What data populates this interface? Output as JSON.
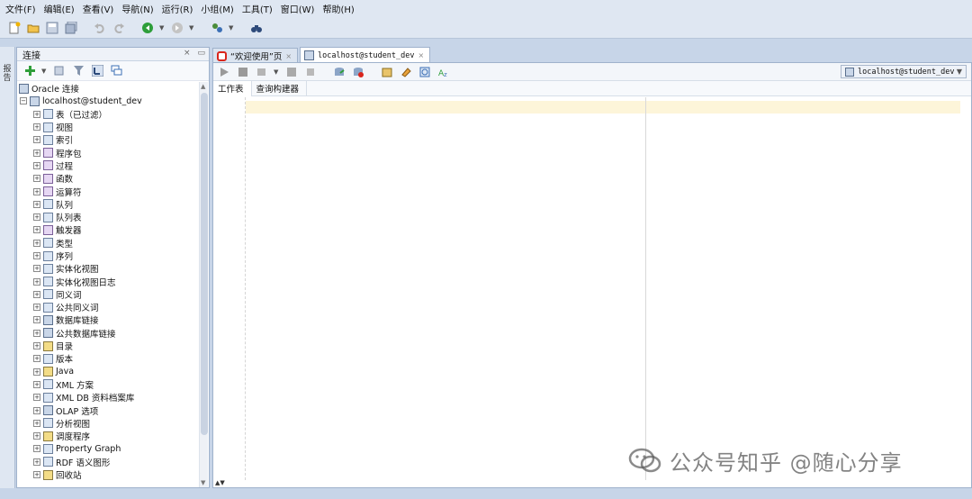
{
  "menu": [
    "文件(F)",
    "编辑(E)",
    "查看(V)",
    "导航(N)",
    "运行(R)",
    "小组(M)",
    "工具(T)",
    "窗口(W)",
    "帮助(H)"
  ],
  "left_panel": {
    "title": "连接",
    "side_strip_label": "报告"
  },
  "tree": {
    "root": "Oracle 连接",
    "connection": "localhost@student_dev",
    "children": [
      "表（已过滤）",
      "视图",
      "索引",
      "程序包",
      "过程",
      "函数",
      "运算符",
      "队列",
      "队列表",
      "触发器",
      "类型",
      "序列",
      "实体化视图",
      "实体化视图日志",
      "同义词",
      "公共同义词",
      "数据库链接",
      "公共数据库链接",
      "目录",
      "版本",
      "Java",
      "XML 方案",
      "XML DB 资料档案库",
      "OLAP 选项",
      "分析视图",
      "调度程序",
      "Property Graph",
      "RDF 语义图形",
      "回收站"
    ]
  },
  "doc_tabs": {
    "welcome": "“欢迎使用”页",
    "worksheet": "localhost@student_dev"
  },
  "editor": {
    "connection_select": "localhost@student_dev",
    "sub_tabs": [
      "工作表",
      "查询构建器"
    ]
  },
  "watermark": "公众号知乎 @随心分享"
}
